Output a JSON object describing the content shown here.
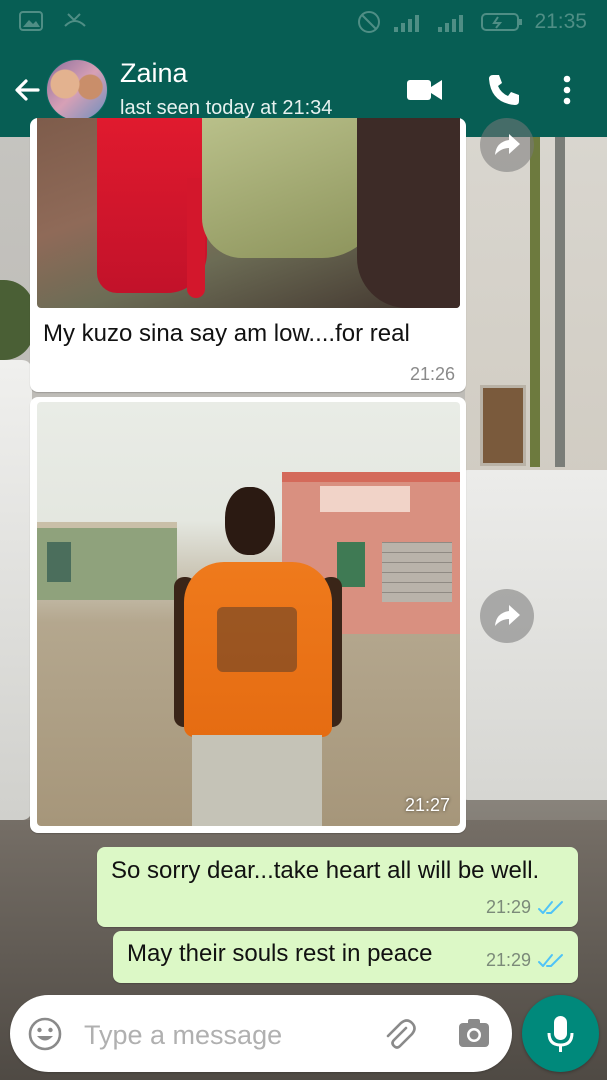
{
  "status_bar": {
    "time": "21:35"
  },
  "header": {
    "contact_name": "Zaina",
    "last_seen": "last seen today at 21:34"
  },
  "messages": [
    {
      "type": "image",
      "direction": "incoming",
      "caption": "My kuzo sina say am low....for real",
      "time": "21:26"
    },
    {
      "type": "image",
      "direction": "incoming",
      "caption": "",
      "time": "21:27"
    },
    {
      "type": "text",
      "direction": "outgoing",
      "text": "So sorry dear...take heart all will be well.",
      "time": "21:29",
      "status": "read"
    },
    {
      "type": "text",
      "direction": "outgoing",
      "text": "May their souls rest in peace",
      "time": "21:29",
      "status": "read"
    }
  ],
  "composer": {
    "placeholder": "Type a message"
  },
  "colors": {
    "header": "#075e54",
    "outgoing_bubble": "#dcf8c6",
    "incoming_bubble": "#ffffff",
    "mic_button": "#00897b",
    "read_ticks": "#4fc3f7"
  },
  "icons": {
    "back": "arrow-left-icon",
    "video": "video-camera-icon",
    "call": "phone-icon",
    "menu": "more-vertical-icon",
    "forward": "forward-arrow-icon",
    "emoji": "smiley-icon",
    "attach": "paperclip-icon",
    "camera": "camera-icon",
    "mic": "microphone-icon"
  }
}
